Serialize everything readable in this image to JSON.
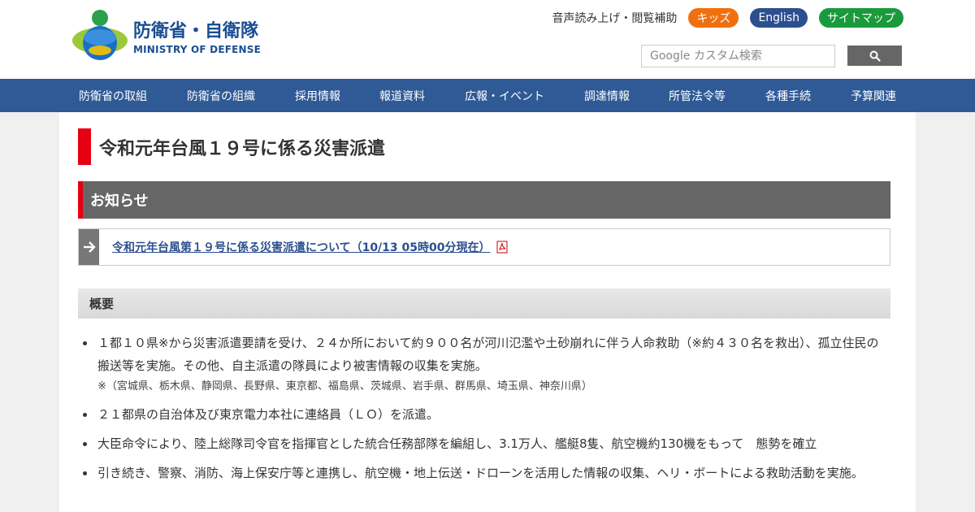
{
  "header": {
    "logo_jp": "防衛省・自衛隊",
    "logo_en": "MINISTRY OF DEFENSE",
    "util_links": {
      "accessibility": "音声読み上げ・閲覧補助",
      "kids": "キッズ",
      "english": "English",
      "sitemap": "サイトマップ"
    },
    "search": {
      "placeholder": "Google カスタム検索",
      "value": ""
    },
    "colors": {
      "kids": "#f07010",
      "english": "#2c4f8f",
      "sitemap": "#1a9a3c",
      "nav": "#2f5a96",
      "accent_red": "#e60012"
    }
  },
  "nav": {
    "items": [
      "防衛省の取組",
      "防衛省の組織",
      "採用情報",
      "報道資料",
      "広報・イベント",
      "調達情報",
      "所管法令等",
      "各種手続",
      "予算関連"
    ]
  },
  "main": {
    "title": "令和元年台風１９号に係る災害派遣",
    "notice": {
      "heading": "お知らせ",
      "link_text": "令和元年台風第１９号に係る災害派遣について（10/13 05時00分現在）",
      "link_icon": "pdf-icon"
    },
    "summary": {
      "heading": "概要",
      "items": [
        {
          "text": "１都１０県※から災害派遣要請を受け、２４か所において約９００名が河川氾濫や土砂崩れに伴う人命救助（※約４３０名を救出）、孤立住民の搬送等を実施。その他、自主派遣の隊員により被害情報の収集を実施。",
          "note": "※（宮城県、栃木県、静岡県、長野県、東京都、福島県、茨城県、岩手県、群馬県、埼玉県、神奈川県）"
        },
        {
          "text": "２１都県の自治体及び東京電力本社に連絡員（ＬＯ）を派遣。"
        },
        {
          "text": "大臣命令により、陸上総隊司令官を指揮官とした統合任務部隊を編組し、3.1万人、艦艇8隻、航空機約130機をもって　態勢を確立"
        },
        {
          "text": "引き続き、警察、消防、海上保安庁等と連携し、航空機・地上伝送・ドローンを活用した情報の収集、ヘリ・ボートによる救助活動を実施。"
        }
      ]
    }
  }
}
